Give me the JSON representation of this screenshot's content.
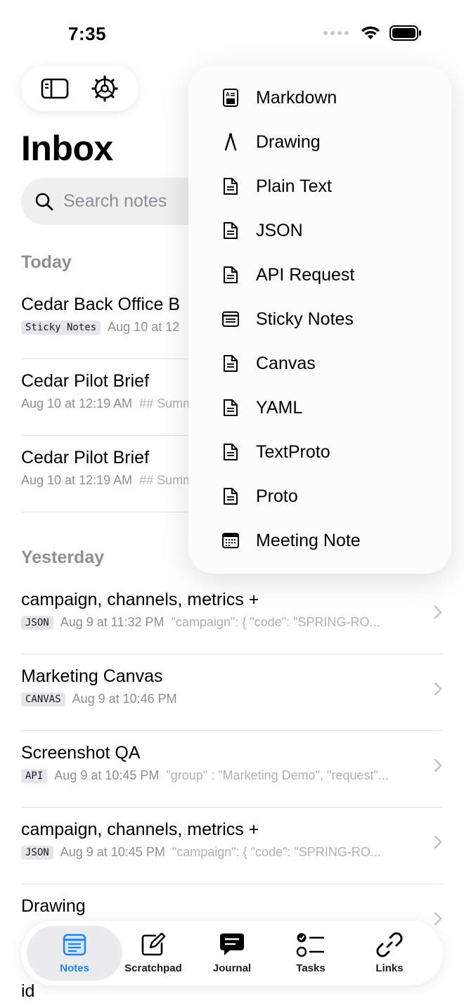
{
  "status_bar": {
    "time": "7:35"
  },
  "header": {
    "title": "Inbox"
  },
  "search": {
    "placeholder": "Search notes"
  },
  "sections": {
    "today": "Today",
    "yesterday": "Yesterday"
  },
  "notes": [
    {
      "title": "Cedar Back Office B",
      "tag": "Sticky Notes",
      "date": "Aug 10 at 12",
      "preview": ""
    },
    {
      "title": "Cedar Pilot Brief",
      "tag": "",
      "date": "Aug 10 at 12:19 AM",
      "preview": "## Summ"
    },
    {
      "title": "Cedar Pilot Brief",
      "tag": "",
      "date": "Aug 10 at 12:19 AM",
      "preview": "## Summ"
    },
    {
      "title": "campaign, channels, metrics +",
      "tag": "JSON",
      "date": "Aug 9 at 11:32 PM",
      "preview": "\"campaign\": {     \"code\": \"SPRING-RO..."
    },
    {
      "title": "Marketing Canvas",
      "tag": "CANVAS",
      "date": "Aug 9 at 10:46 PM",
      "preview": ""
    },
    {
      "title": "Screenshot QA",
      "tag": "API",
      "date": "Aug 9 at 10:45 PM",
      "preview": "\"group\" : \"Marketing Demo\",   \"request\"..."
    },
    {
      "title": "campaign, channels, metrics +",
      "tag": "JSON",
      "date": "Aug 9 at 10:45 PM",
      "preview": "\"campaign\": {     \"code\": \"SPRING-RO..."
    },
    {
      "title": "Drawing",
      "tag": "",
      "date": "",
      "preview": ""
    },
    {
      "title": "id",
      "tag": "",
      "date": "",
      "preview": ""
    }
  ],
  "new_note_menu": {
    "items": [
      {
        "label": "Markdown",
        "icon": "markdown-doc-icon"
      },
      {
        "label": "Drawing",
        "icon": "pen-nib-icon"
      },
      {
        "label": "Plain Text",
        "icon": "document-icon"
      },
      {
        "label": "JSON",
        "icon": "document-icon"
      },
      {
        "label": "API Request",
        "icon": "document-icon"
      },
      {
        "label": "Sticky Notes",
        "icon": "list-note-icon"
      },
      {
        "label": "Canvas",
        "icon": "document-icon"
      },
      {
        "label": "YAML",
        "icon": "document-icon"
      },
      {
        "label": "TextProto",
        "icon": "document-icon"
      },
      {
        "label": "Proto",
        "icon": "document-icon"
      },
      {
        "label": "Meeting Note",
        "icon": "calendar-icon"
      }
    ]
  },
  "tabs": [
    {
      "label": "Notes",
      "icon": "notes-icon",
      "active": true
    },
    {
      "label": "Scratchpad",
      "icon": "compose-icon",
      "active": false
    },
    {
      "label": "Journal",
      "icon": "journal-bubble-icon",
      "active": false
    },
    {
      "label": "Tasks",
      "icon": "checklist-icon",
      "active": false
    },
    {
      "label": "Links",
      "icon": "link-icon",
      "active": false
    }
  ],
  "colors": {
    "accent": "#1a84ff",
    "secondary_text": "#8e8e93",
    "tag_bg": "#e5e5ea"
  }
}
